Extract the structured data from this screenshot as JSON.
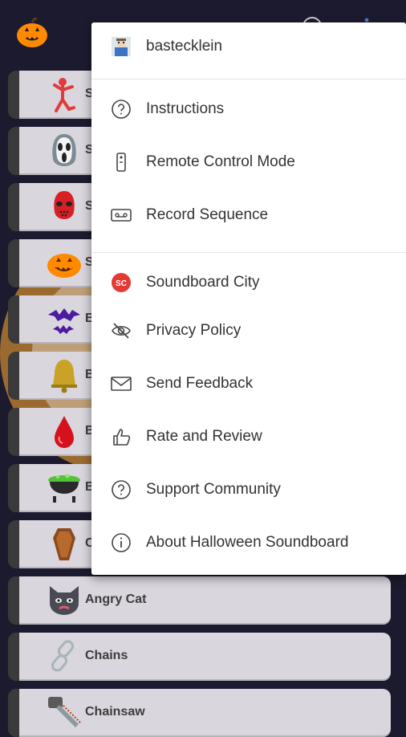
{
  "menu": {
    "account": {
      "label": "bastecklein",
      "icon": "user-avatar-icon"
    },
    "items": [
      {
        "label": "Instructions",
        "icon": "help-circle-icon"
      },
      {
        "label": "Remote Control Mode",
        "icon": "remote-control-icon"
      },
      {
        "label": "Record Sequence",
        "icon": "cassette-icon"
      },
      {
        "label": "Soundboard City",
        "icon": "soundboard-city-logo-icon",
        "color": "#e53935"
      },
      {
        "label": "Privacy Policy",
        "icon": "eye-off-icon"
      },
      {
        "label": "Send Feedback",
        "icon": "envelope-icon"
      },
      {
        "label": "Rate and Review",
        "icon": "thumbs-up-icon"
      },
      {
        "label": "Support Community",
        "icon": "help-circle-icon"
      },
      {
        "label": "About Halloween Soundboard",
        "icon": "info-circle-icon"
      }
    ]
  },
  "sounds": [
    {
      "label": "S",
      "icon": "dancing-skeleton-icon"
    },
    {
      "label": "S",
      "icon": "ghost-mask-icon"
    },
    {
      "label": "S",
      "icon": "hockey-mask-icon"
    },
    {
      "label": "S",
      "icon": "jack-o-lantern-icon"
    },
    {
      "label": "B",
      "icon": "bats-icon"
    },
    {
      "label": "B",
      "icon": "bell-icon"
    },
    {
      "label": "B",
      "icon": "blood-drop-icon"
    },
    {
      "label": "B",
      "icon": "cauldron-icon"
    },
    {
      "label": "C",
      "icon": "coffin-icon"
    },
    {
      "label": "Angry Cat",
      "icon": "angry-cat-icon"
    },
    {
      "label": "Chains",
      "icon": "chains-icon"
    },
    {
      "label": "Chainsaw",
      "icon": "chainsaw-icon"
    }
  ],
  "colors": {
    "background": "#1c1a2e",
    "button": "#d9d6dd",
    "accent": "#ff8a00"
  }
}
